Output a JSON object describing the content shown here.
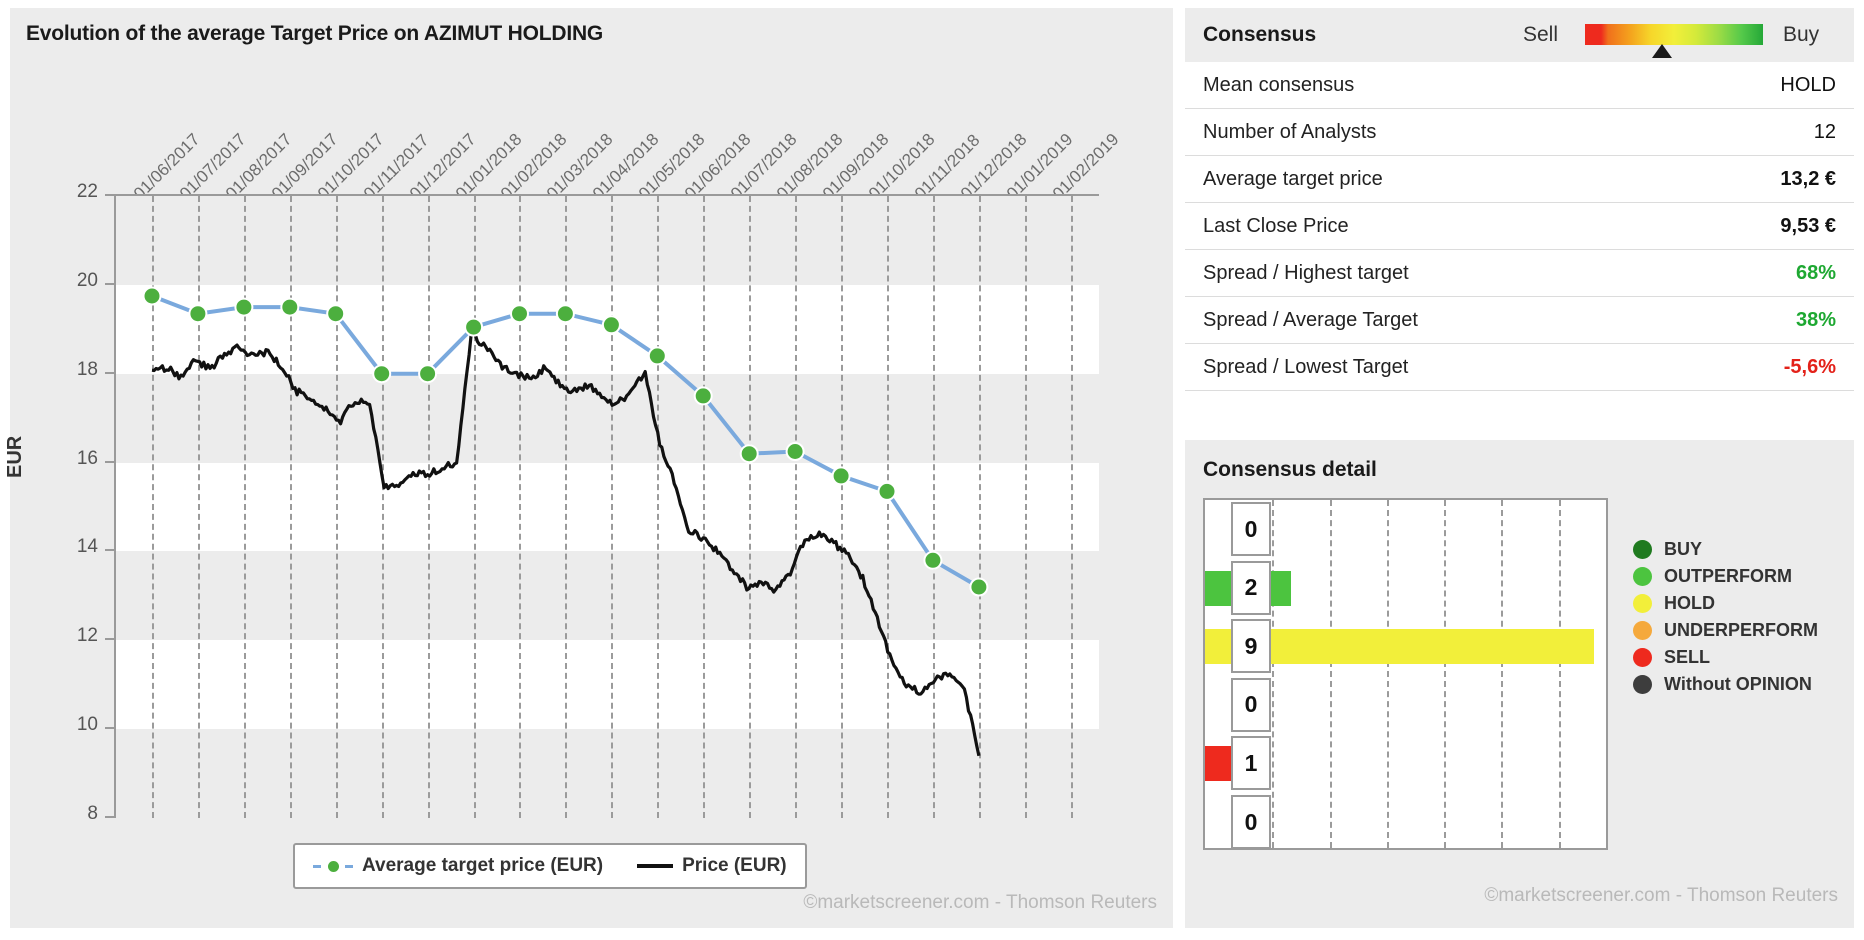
{
  "chart_panel": {
    "title": "Evolution of the average Target Price on AZIMUT HOLDING",
    "copyright": "©marketscreener.com - Thomson Reuters",
    "legend": {
      "target_label": "Average target price (EUR)",
      "price_label": "Price (EUR)"
    }
  },
  "chart_data": {
    "type": "line",
    "title": "Evolution of the average Target Price on AZIMUT HOLDING",
    "xlabel": "",
    "ylabel": "EUR",
    "ylim": [
      8,
      22
    ],
    "yticks": [
      8,
      10,
      12,
      14,
      16,
      18,
      20,
      22
    ],
    "grid": true,
    "legend_position": "bottom",
    "xtick_labels": [
      "01/06/2017",
      "01/07/2017",
      "01/08/2017",
      "01/09/2017",
      "01/10/2017",
      "01/11/2017",
      "01/12/2017",
      "01/01/2018",
      "01/02/2018",
      "01/03/2018",
      "01/04/2018",
      "01/05/2018",
      "01/06/2018",
      "01/07/2018",
      "01/08/2018",
      "01/09/2018",
      "01/10/2018",
      "01/11/2018",
      "01/12/2018",
      "01/01/2019",
      "01/02/2019"
    ],
    "series": [
      {
        "name": "Average target price (EUR)",
        "color": "#7aa9dd",
        "marker_color": "#4caf3e",
        "style": "dashed-markers",
        "x": [
          "01/06/2017",
          "01/07/2017",
          "01/08/2017",
          "01/09/2017",
          "01/10/2017",
          "01/11/2017",
          "01/12/2017",
          "01/01/2018",
          "01/02/2018",
          "01/03/2018",
          "01/04/2018",
          "01/05/2018",
          "01/06/2018",
          "01/07/2018",
          "01/08/2018",
          "01/09/2018",
          "01/10/2018",
          "01/11/2018",
          "01/12/2018",
          "01/01/2019"
        ],
        "values": [
          19.75,
          19.35,
          19.5,
          19.5,
          19.35,
          18.0,
          18.0,
          19.05,
          19.35,
          19.35,
          19.1,
          18.4,
          17.5,
          16.2,
          16.25,
          15.7,
          15.35,
          13.8,
          13.2
        ]
      },
      {
        "name": "Price (EUR)",
        "color": "#111111",
        "style": "solid",
        "values": [
          18.0,
          18.15,
          17.9,
          18.3,
          18.1,
          18.45,
          18.6,
          18.4,
          18.5,
          18.1,
          17.6,
          17.45,
          17.2,
          16.95,
          17.4,
          17.3,
          15.5,
          15.45,
          15.8,
          15.7,
          15.9,
          16.0,
          18.9,
          18.6,
          18.2,
          18.0,
          17.9,
          18.1,
          17.8,
          17.6,
          17.75,
          17.5,
          17.3,
          17.6,
          18.0,
          16.4,
          15.6,
          14.5,
          14.3,
          14.0,
          13.6,
          13.2,
          13.3,
          13.1,
          13.5,
          14.3,
          14.4,
          14.2,
          13.9,
          13.4,
          12.5,
          11.5,
          11.0,
          10.8,
          11.1,
          11.3,
          10.9,
          9.4
        ]
      }
    ]
  },
  "consensus": {
    "title": "Consensus",
    "sell_label": "Sell",
    "buy_label": "Buy",
    "gauge_marker_position_pct": 50,
    "rows": [
      {
        "label": "Mean consensus",
        "value": "HOLD",
        "style": "plain"
      },
      {
        "label": "Number of Analysts",
        "value": "12",
        "style": "plain"
      },
      {
        "label": "Average target price",
        "value": "13,2 €",
        "style": "bold"
      },
      {
        "label": "Last Close Price",
        "value": "9,53 €",
        "style": "bold"
      },
      {
        "label": "Spread / Highest target",
        "value": "68%",
        "style": "green"
      },
      {
        "label": "Spread / Average Target",
        "value": "38%",
        "style": "green"
      },
      {
        "label": "Spread / Lowest Target",
        "value": "-5,6%",
        "style": "red"
      }
    ]
  },
  "consensus_detail": {
    "title": "Consensus detail",
    "copyright": "©marketscreener.com - Thomson Reuters",
    "bars": [
      {
        "label": "BUY",
        "count": "0",
        "color": "#1f7a1f",
        "bar_pct": 0
      },
      {
        "label": "OUTPERFORM",
        "count": "2",
        "color": "#4cc43f",
        "bar_pct": 22
      },
      {
        "label": "HOLD",
        "count": "9",
        "color": "#f2ef3a",
        "bar_pct": 100
      },
      {
        "label": "UNDERPERFORM",
        "count": "0",
        "color": "#f5a93c",
        "bar_pct": 0
      },
      {
        "label": "SELL",
        "count": "1",
        "color": "#ee2a1e",
        "bar_pct": 11
      },
      {
        "label": "Without OPINION",
        "count": "0",
        "color": "#3d3d3d",
        "bar_pct": 0
      }
    ],
    "legend": [
      {
        "label": "BUY",
        "color": "#1f7a1f"
      },
      {
        "label": "OUTPERFORM",
        "color": "#4cc43f"
      },
      {
        "label": "HOLD",
        "color": "#f2ef3a"
      },
      {
        "label": "UNDERPERFORM",
        "color": "#f5a93c"
      },
      {
        "label": "SELL",
        "color": "#ee2a1e"
      },
      {
        "label": "Without OPINION",
        "color": "#3d3d3d"
      }
    ]
  }
}
